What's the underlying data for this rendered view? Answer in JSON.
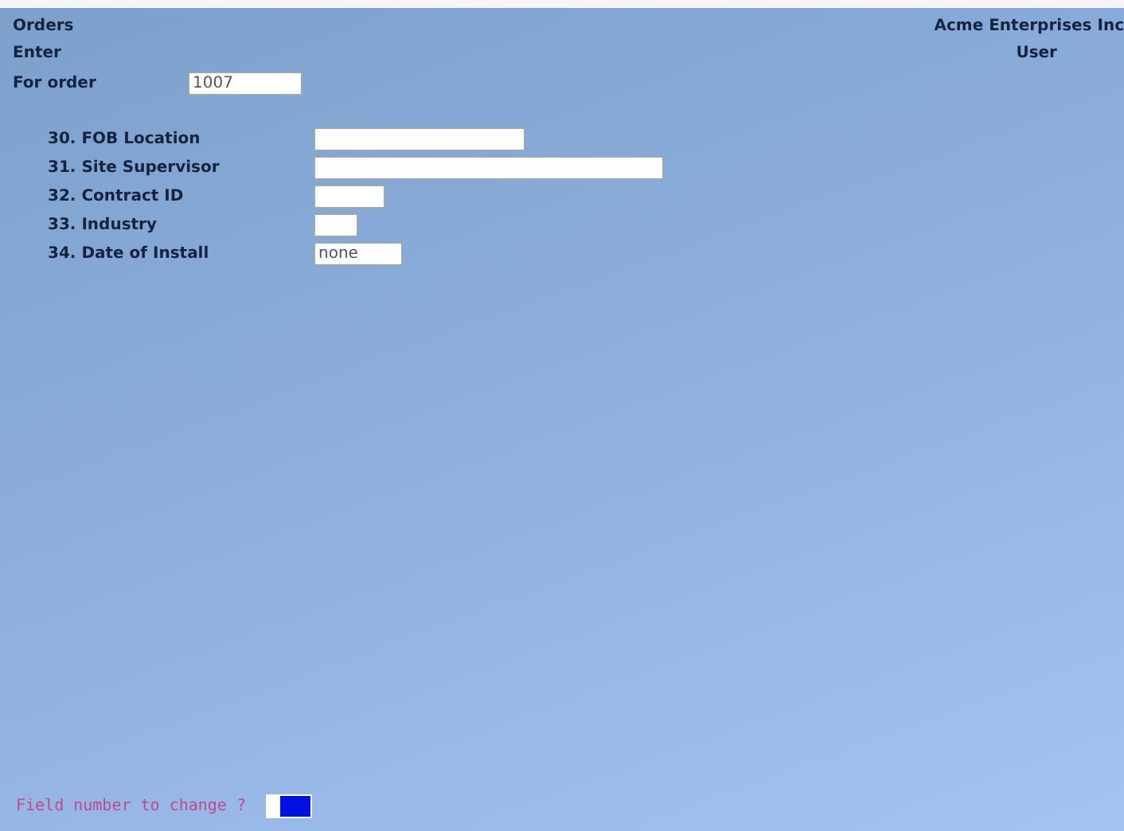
{
  "header": {
    "title": "Orders",
    "company": "Acme Enterprises Inc",
    "mode": "Enter",
    "user": "User"
  },
  "order": {
    "label": "For order",
    "value": "1007"
  },
  "fields": [
    {
      "label": "30. FOB Location"
    },
    {
      "label": "31. Site Supervisor"
    },
    {
      "label": "32. Contract ID"
    },
    {
      "label": "33. Industry"
    },
    {
      "label": "34. Date of Install",
      "value": "none"
    }
  ],
  "prompt": {
    "label": "Field number to change ?"
  }
}
